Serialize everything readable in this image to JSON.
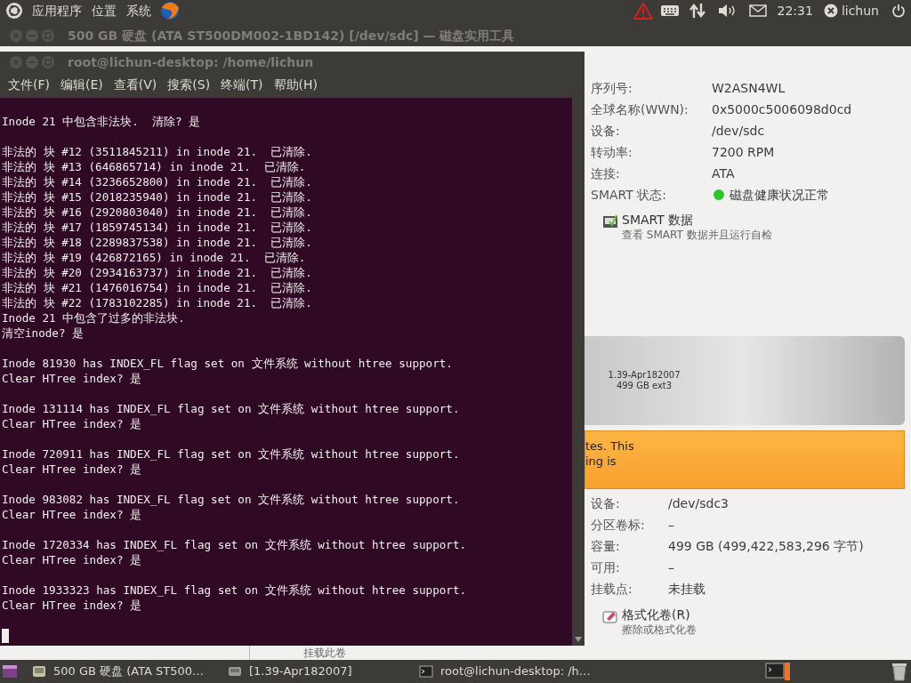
{
  "top_panel": {
    "menus": [
      "应用程序",
      "位置",
      "系统"
    ],
    "clock": "22:31",
    "user": "lichun"
  },
  "disk_window": {
    "title": "500 GB 硬盘 (ATA ST500DM002-1BD142) [/dev/sdc] — 磁盘实用工具",
    "drive_info": [
      {
        "label": "序列号:",
        "value": "W2ASN4WL"
      },
      {
        "label": "全球名称(WWN):",
        "value": "0x5000c5006098d0cd"
      },
      {
        "label": "设备:",
        "value": "/dev/sdc"
      },
      {
        "label": "转动率:",
        "value": "7200 RPM"
      },
      {
        "label": "连接:",
        "value": "ATA"
      },
      {
        "label": "SMART 状态:",
        "value": "磁盘健康状况正常"
      }
    ],
    "smart_action": {
      "title": "SMART 数据",
      "subtitle": "查看 SMART 数据并且运行自检"
    },
    "partition_bar": {
      "lines": [
        "1.39-Apr182007",
        "499 GB ext3"
      ]
    },
    "warning": [
      "tes. This",
      "ing is"
    ],
    "volume_info": [
      {
        "label": "设备:",
        "value": "/dev/sdc3"
      },
      {
        "label": "分区卷标:",
        "value": "–"
      },
      {
        "label": "容量:",
        "value": "499 GB (499,422,583,296 字节)"
      },
      {
        "label": "可用:",
        "value": "–"
      },
      {
        "label": "挂载点:",
        "value": "未挂载"
      }
    ],
    "format_action": {
      "title": "格式化卷(R)",
      "subtitle": "擦除或格式化卷"
    },
    "mount_caption": "挂载此卷"
  },
  "terminal": {
    "title": "root@lichun-desktop: /home/lichun",
    "menu": [
      "文件(F)",
      "编辑(E)",
      "查看(V)",
      "搜索(S)",
      "终端(T)",
      "帮助(H)"
    ],
    "blocks": [
      [
        "Inode 21 中包含非法块.  清除? 是"
      ],
      [
        "非法的 块 #12 (3511845211) in inode 21.  已清除.",
        "非法的 块 #13 (646865714) in inode 21.  已清除.",
        "非法的 块 #14 (3236652800) in inode 21.  已清除.",
        "非法的 块 #15 (2018235940) in inode 21.  已清除.",
        "非法的 块 #16 (2920803040) in inode 21.  已清除.",
        "非法的 块 #17 (1859745134) in inode 21.  已清除.",
        "非法的 块 #18 (2289837538) in inode 21.  已清除.",
        "非法的 块 #19 (426872165) in inode 21.  已清除.",
        "非法的 块 #20 (2934163737) in inode 21.  已清除.",
        "非法的 块 #21 (1476016754) in inode 21.  已清除.",
        "非法的 块 #22 (1783102285) in inode 21.  已清除.",
        "Inode 21 中包含了过多的非法块.",
        "清空inode? 是"
      ],
      [
        "Inode 81930 has INDEX_FL flag set on 文件系统 without htree support.",
        "Clear HTree index? 是"
      ],
      [
        "Inode 131114 has INDEX_FL flag set on 文件系统 without htree support.",
        "Clear HTree index? 是"
      ],
      [
        "Inode 720911 has INDEX_FL flag set on 文件系统 without htree support.",
        "Clear HTree index? 是"
      ],
      [
        "Inode 983082 has INDEX_FL flag set on 文件系统 without htree support.",
        "Clear HTree index? 是"
      ],
      [
        "Inode 1720334 has INDEX_FL flag set on 文件系统 without htree support.",
        "Clear HTree index? 是"
      ],
      [
        "Inode 1933323 has INDEX_FL flag set on 文件系统 without htree support.",
        "Clear HTree index? 是"
      ]
    ]
  },
  "taskbar": {
    "tasks": [
      {
        "kind": "disk",
        "label": "500 GB 硬盘 (ATA ST500…"
      },
      {
        "kind": "volume",
        "label": "[1.39-Apr182007]"
      },
      {
        "kind": "terminal",
        "label": "root@lichun-desktop: /h…"
      }
    ]
  }
}
